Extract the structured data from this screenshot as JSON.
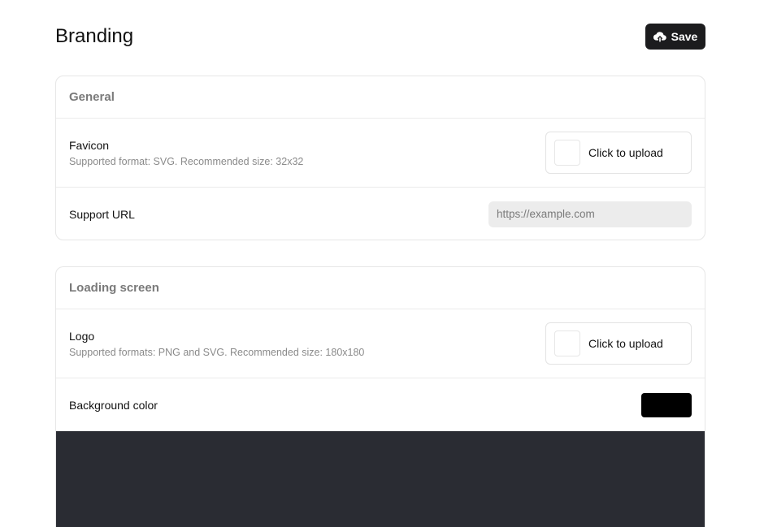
{
  "header": {
    "title": "Branding",
    "save_label": "Save"
  },
  "general": {
    "title": "General",
    "favicon": {
      "label": "Favicon",
      "description": "Supported format: SVG. Recommended size: 32x32",
      "upload_label": "Click to upload"
    },
    "support_url": {
      "label": "Support URL",
      "placeholder": "https://example.com",
      "value": ""
    }
  },
  "loading_screen": {
    "title": "Loading screen",
    "logo": {
      "label": "Logo",
      "description": "Supported formats: PNG and SVG. Recommended size: 180x180",
      "upload_label": "Click to upload"
    },
    "background_color": {
      "label": "Background color",
      "value": "#000000"
    },
    "preview_color": "#2a2c33"
  },
  "icons": {
    "save": "cloud-upload-icon"
  }
}
